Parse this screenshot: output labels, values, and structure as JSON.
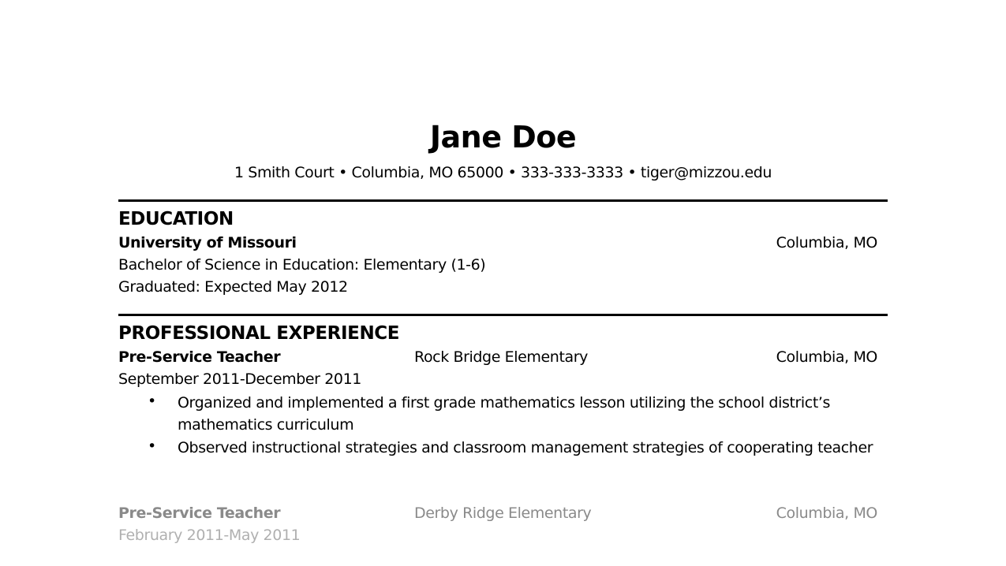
{
  "header": {
    "name": "Jane Doe",
    "contact": "1 Smith Court • Columbia, MO 65000 • 333-333-3333 • tiger@mizzou.edu"
  },
  "education": {
    "title": "EDUCATION",
    "school": "University of Missouri",
    "location": "Columbia, MO",
    "degree": "Bachelor of Science in Education:  Elementary (1-6)",
    "graduated": "Graduated:  Expected May 2012"
  },
  "experience": {
    "title": "PROFESSIONAL EXPERIENCE",
    "jobs": [
      {
        "role": "Pre-Service Teacher",
        "organization": "Rock Bridge Elementary",
        "location": "Columbia, MO",
        "dates": "September 2011-December 2011",
        "bullets": [
          "Organized and implemented a first grade mathematics lesson utilizing the school district’s mathematics curriculum",
          "Observed instructional strategies and classroom management strategies of cooperating teacher"
        ]
      },
      {
        "role": "Pre-Service Teacher",
        "organization": "Derby Ridge Elementary",
        "location": "Columbia, MO",
        "dates": "February 2011-May 2011"
      }
    ]
  },
  "bullet_glyph": "•"
}
